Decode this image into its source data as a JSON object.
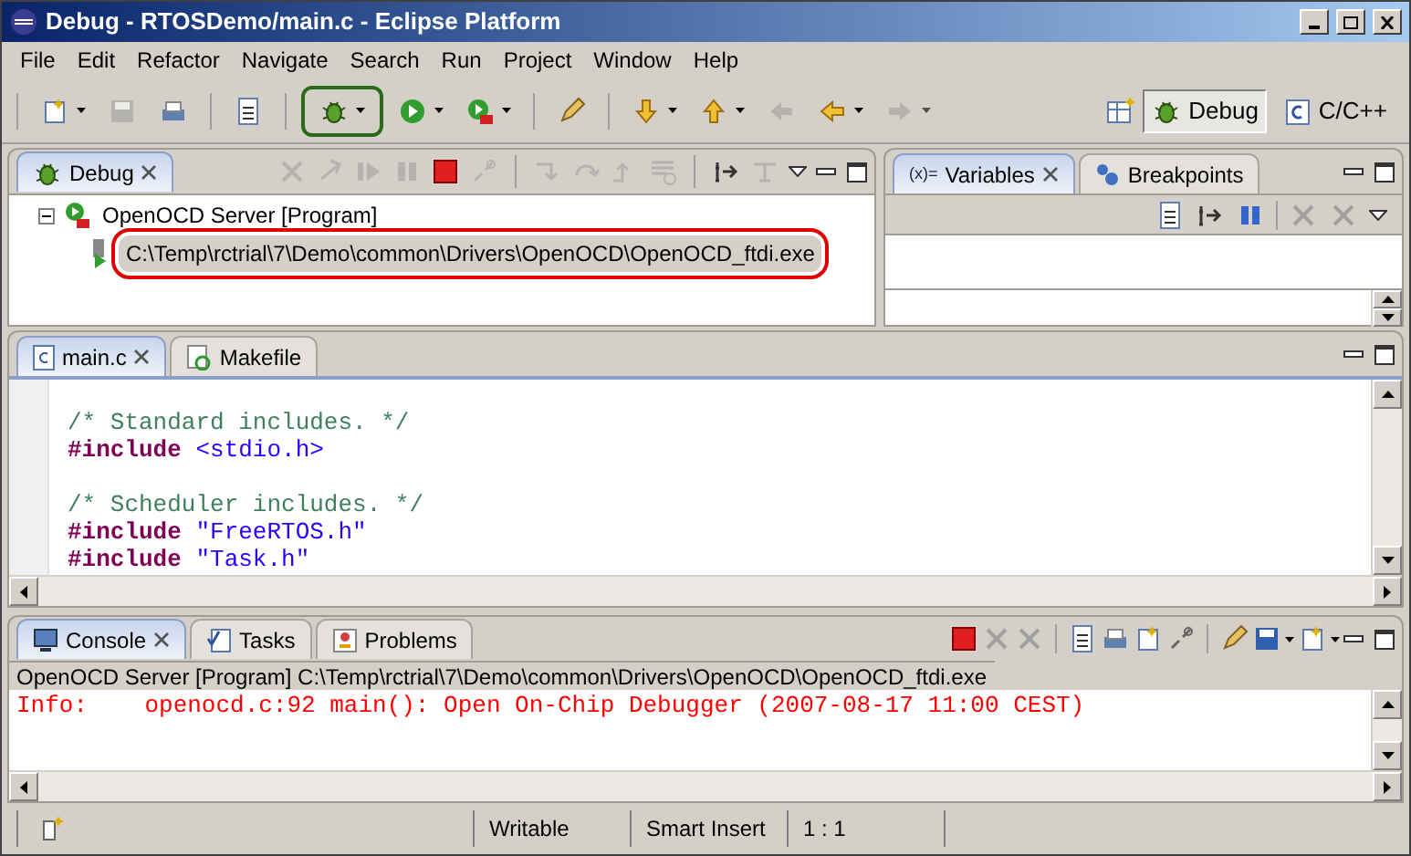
{
  "window": {
    "title": "Debug - RTOSDemo/main.c - Eclipse Platform"
  },
  "menu": [
    "File",
    "Edit",
    "Refactor",
    "Navigate",
    "Search",
    "Run",
    "Project",
    "Window",
    "Help"
  ],
  "toolbar": [
    {
      "kind": "new",
      "disabled": false,
      "highlighted": false
    },
    {
      "kind": "save",
      "disabled": true,
      "highlighted": false
    },
    {
      "kind": "print",
      "disabled": false,
      "highlighted": false
    },
    {
      "kind": "sep"
    },
    {
      "kind": "binary",
      "disabled": false,
      "highlighted": false
    },
    {
      "kind": "sep"
    },
    {
      "kind": "debug",
      "disabled": false,
      "highlighted": true
    },
    {
      "kind": "run",
      "disabled": false,
      "highlighted": false
    },
    {
      "kind": "external",
      "disabled": false,
      "highlighted": false
    },
    {
      "kind": "sep"
    },
    {
      "kind": "pen",
      "disabled": false,
      "highlighted": false
    },
    {
      "kind": "sep"
    },
    {
      "kind": "down",
      "disabled": false,
      "highlighted": false
    },
    {
      "kind": "up",
      "disabled": false,
      "highlighted": false
    },
    {
      "kind": "back",
      "disabled": true,
      "highlighted": false
    },
    {
      "kind": "left",
      "disabled": false,
      "highlighted": false
    },
    {
      "kind": "right",
      "disabled": true,
      "highlighted": false
    }
  ],
  "perspectives": [
    {
      "label": "Debug",
      "selected": true
    },
    {
      "label": "C/C++",
      "selected": false
    }
  ],
  "debug_view": {
    "tabs": [
      {
        "label": "Debug",
        "selected": true
      }
    ],
    "toolbar": [
      {
        "kind": "remove",
        "disabled": true
      },
      {
        "kind": "relaunch",
        "disabled": true
      },
      {
        "kind": "resume",
        "disabled": true
      },
      {
        "kind": "suspend",
        "disabled": true
      },
      {
        "kind": "terminate",
        "disabled": false
      },
      {
        "kind": "disconnect",
        "disabled": true
      },
      {
        "kind": "sep"
      },
      {
        "kind": "stepinto",
        "disabled": true
      },
      {
        "kind": "stepover",
        "disabled": true
      },
      {
        "kind": "stepreturn",
        "disabled": true
      },
      {
        "kind": "dropframe",
        "disabled": true
      },
      {
        "kind": "sep"
      },
      {
        "kind": "instruction",
        "disabled": false
      },
      {
        "kind": "filters",
        "disabled": true
      }
    ],
    "tree": [
      {
        "label": "OpenOCD Server [Program]",
        "expanded": true,
        "highlighted": false,
        "children": [
          {
            "label": "C:\\Temp\\rctrial\\7\\Demo\\common\\Drivers\\OpenOCD\\OpenOCD_ftdi.exe",
            "highlighted": true,
            "selected": true
          }
        ]
      }
    ]
  },
  "variables_view": {
    "tabs": [
      {
        "label": "Variables",
        "icon_text": "(x)=",
        "selected": true
      },
      {
        "label": "Breakpoints",
        "selected": false
      }
    ]
  },
  "editor": {
    "tabs": [
      {
        "label": "main.c",
        "selected": true
      },
      {
        "label": "Makefile",
        "selected": false
      }
    ],
    "lines": [
      {
        "kind": "blank"
      },
      {
        "kind": "code",
        "parts": [
          {
            "kind": "comment",
            "text": "/* Standard includes. */"
          }
        ]
      },
      {
        "kind": "code",
        "parts": [
          {
            "kind": "directive",
            "text": "#include"
          },
          {
            "kind": "header",
            "text": "<stdio.h>"
          }
        ]
      },
      {
        "kind": "blank"
      },
      {
        "kind": "code",
        "parts": [
          {
            "kind": "comment",
            "text": "/* Scheduler includes. */"
          }
        ]
      },
      {
        "kind": "code",
        "parts": [
          {
            "kind": "directive",
            "text": "#include"
          },
          {
            "kind": "header",
            "text": "\"FreeRTOS.h\""
          }
        ]
      },
      {
        "kind": "code",
        "parts": [
          {
            "kind": "directive",
            "text": "#include"
          },
          {
            "kind": "header",
            "text": "\"Task.h\""
          }
        ]
      }
    ]
  },
  "console_view": {
    "tabs": [
      {
        "label": "Console",
        "selected": true
      },
      {
        "label": "Tasks",
        "selected": false
      },
      {
        "label": "Problems",
        "selected": false
      }
    ],
    "process": "OpenOCD Server [Program] C:\\Temp\\rctrial\\7\\Demo\\common\\Drivers\\OpenOCD\\OpenOCD_ftdi.exe",
    "output": [
      "Info:    openocd.c:92 main(): Open On-Chip Debugger (2007-08-17 11:00 CEST)"
    ]
  },
  "status_bar": [
    "Writable",
    "Smart Insert",
    "1 : 1"
  ]
}
